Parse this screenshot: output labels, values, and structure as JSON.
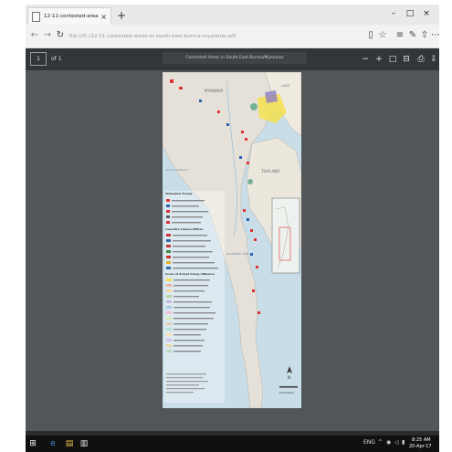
{
  "browser": {
    "tab_title": "12-11-contested-areas-",
    "tab_close": "×",
    "new_tab": "+",
    "url": "file:///C:/12-11-contested-areas-in-south-east-burma-myanmar.pdf",
    "window_controls": [
      "–",
      "□",
      "×"
    ]
  },
  "pdf_toolbar": {
    "page_number": "1",
    "page_of": "of 1",
    "document_title": "Contested Areas in South East Burma/Myanmar"
  },
  "map": {
    "country_labels": [
      "MYANMAR",
      "THAILAND",
      "LAOS"
    ],
    "sea_label": "Andaman Sea",
    "gulf_label": "Gulf of Thailand",
    "legend_heading_1": "Tatmadaw Troops",
    "legend_heading_2": "Ceasefire Liaison Offices",
    "legend_heading_3": "Areas of Armed Group Influence",
    "north_arrow": "N",
    "scale_label": "Kilometers"
  },
  "taskbar": {
    "language": "ENG",
    "time": "8:25 AM",
    "date": "20-Apr-17"
  },
  "colors": {
    "tabbar": "#e9e9e9",
    "pdf_toolbar": "#323639",
    "viewer_bg": "#525659",
    "taskbar": "#101010",
    "sea": "#c9dde9",
    "land": "#e6e1d8"
  }
}
